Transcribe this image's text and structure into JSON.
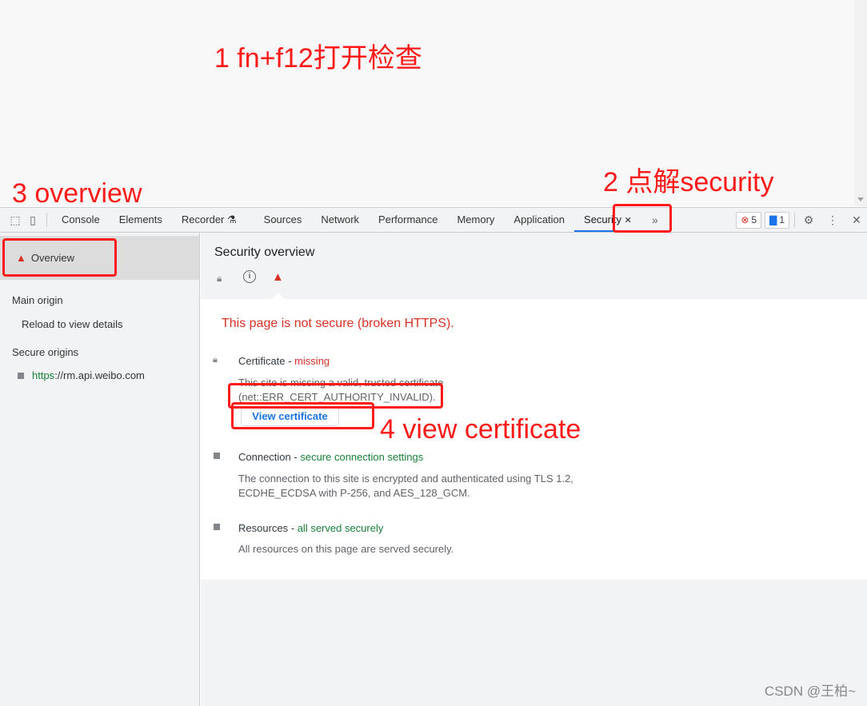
{
  "annotations": {
    "step1": "1 fn+f12打开检查",
    "step2": "2 点解security",
    "step3": "3 overview",
    "step4": "4 view certificate"
  },
  "toolbar": {
    "tabs": [
      "Console",
      "Elements",
      "Recorder",
      "Sources",
      "Network",
      "Performance",
      "Memory",
      "Application",
      "Security"
    ],
    "active_tab": "Security",
    "errors_count": "5",
    "messages_count": "1",
    "more_tabs_icon": "»",
    "close_icon": "✕"
  },
  "sidebar": {
    "overview": "Overview",
    "main_origin": "Main origin",
    "reload": "Reload to view details",
    "secure_origins": "Secure origins",
    "origin_scheme": "https",
    "origin_rest": "://rm.api.weibo.com"
  },
  "main": {
    "title": "Security overview",
    "summary": "This page is not secure (broken HTTPS).",
    "certificate": {
      "label": "Certificate",
      "sep": " - ",
      "status": "missing",
      "desc1": "This site is missing a valid, trusted certificate",
      "desc2": "(net::ERR_CERT_AUTHORITY_INVALID).",
      "button": "View certificate"
    },
    "connection": {
      "label": "Connection",
      "sep": " - ",
      "status": "secure connection settings",
      "desc1": "The connection to this site is encrypted and authenticated using TLS 1.2,",
      "desc2": "ECDHE_ECDSA with P-256, and AES_128_GCM."
    },
    "resources": {
      "label": "Resources",
      "sep": " - ",
      "status": "all served securely",
      "desc1": "All resources on this page are served securely."
    }
  },
  "watermark": "CSDN @王柏~",
  "colors": {
    "accent": "#1a73e8",
    "error": "#d93025",
    "secure": "#188038",
    "annotation": "#ff1a1a"
  }
}
